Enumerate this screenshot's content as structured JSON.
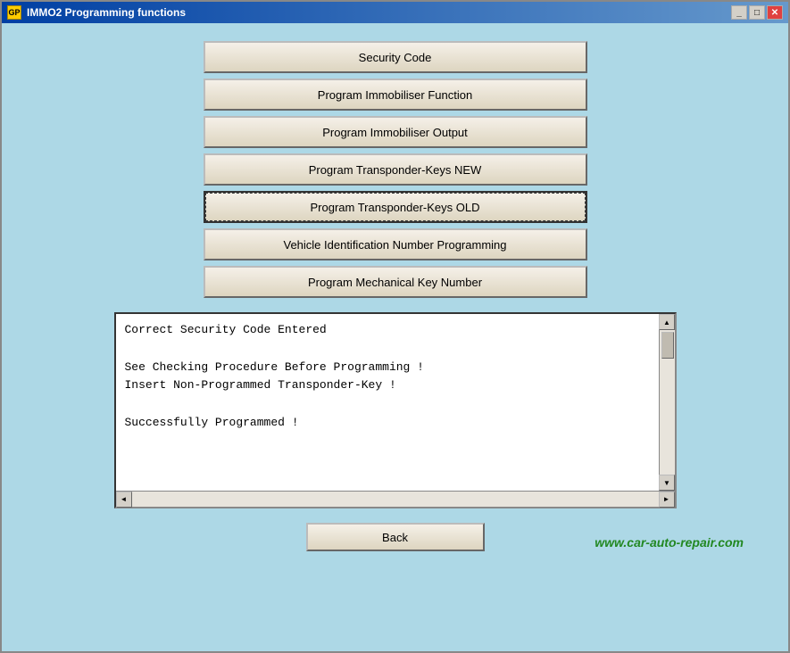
{
  "window": {
    "title": "IMMO2 Programming functions",
    "icon_label": "GP",
    "controls": {
      "minimize": "_",
      "maximize": "□",
      "close": "✕"
    }
  },
  "buttons": [
    {
      "id": "security-code",
      "label": "Security Code",
      "selected": false
    },
    {
      "id": "program-immobiliser-function",
      "label": "Program Immobiliser Function",
      "selected": false
    },
    {
      "id": "program-immobiliser-output",
      "label": "Program Immobiliser Output",
      "selected": false
    },
    {
      "id": "program-transponder-keys-new",
      "label": "Program Transponder-Keys NEW",
      "selected": false
    },
    {
      "id": "program-transponder-keys-old",
      "label": "Program Transponder-Keys OLD",
      "selected": true
    },
    {
      "id": "vehicle-identification-number",
      "label": "Vehicle Identification Number Programming",
      "selected": false
    },
    {
      "id": "program-mechanical-key-number",
      "label": "Program Mechanical Key Number",
      "selected": false
    }
  ],
  "log": {
    "content": "Correct Security Code Entered\n\nSee Checking Procedure Before Programming !\nInsert Non-Programmed Transponder-Key !\n\nSuccessfully Programmed !"
  },
  "back_button": {
    "label": "Back"
  },
  "watermark": {
    "text": "www.car-auto-repair.com"
  },
  "scrollbar": {
    "up_arrow": "▲",
    "down_arrow": "▼",
    "left_arrow": "◄",
    "right_arrow": "►"
  }
}
